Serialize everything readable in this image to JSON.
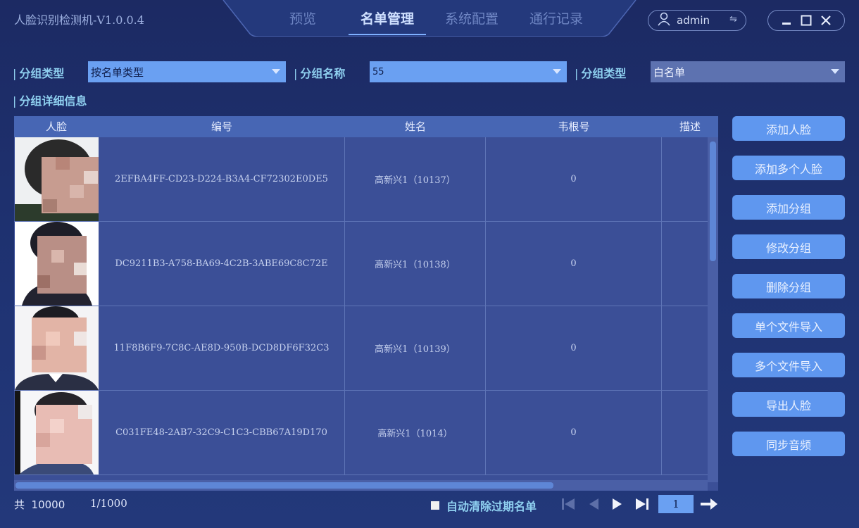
{
  "app": {
    "title": "人脸识别检测机-V1.0.0.4"
  },
  "nav": {
    "tabs": [
      {
        "label": "预览"
      },
      {
        "label": "名单管理"
      },
      {
        "label": "系统配置"
      },
      {
        "label": "通行记录"
      }
    ],
    "active_index": 1
  },
  "user": {
    "name": "admin",
    "switch_icon": "⇋"
  },
  "filters": {
    "group_type_label": "分组类型",
    "group_type_value": "按名单类型",
    "group_name_label": "分组名称",
    "group_name_value": "55",
    "list_type_label": "分组类型",
    "list_type_value": "白名单",
    "detail_label": "分组详细信息"
  },
  "table": {
    "headers": {
      "face": "人脸",
      "id": "编号",
      "name": "姓名",
      "wiegand": "韦根号",
      "desc": "描述"
    },
    "rows": [
      {
        "id": "2EFBA4FF-CD23-D224-B3A4-CF72302E0DE5",
        "name": "高新兴1（10137）",
        "wiegand": "0",
        "desc": ""
      },
      {
        "id": "DC9211B3-A758-BA69-4C2B-3ABE69C8C72E",
        "name": "高新兴1（10138）",
        "wiegand": "0",
        "desc": ""
      },
      {
        "id": "11F8B6F9-7C8C-AE8D-950B-DCD8DF6F32C3",
        "name": "高新兴1（10139）",
        "wiegand": "0",
        "desc": ""
      },
      {
        "id": "C031FE48-2AB7-32C9-C1C3-CBB67A19D170",
        "name": "高新兴1（1014）",
        "wiegand": "0",
        "desc": ""
      }
    ]
  },
  "actions": [
    {
      "label": "添加人脸"
    },
    {
      "label": "添加多个人脸"
    },
    {
      "label": "添加分组"
    },
    {
      "label": "修改分组"
    },
    {
      "label": "删除分组"
    },
    {
      "label": "单个文件导入"
    },
    {
      "label": "多个文件导入"
    },
    {
      "label": "导出人脸"
    },
    {
      "label": "同步音频"
    }
  ],
  "footer": {
    "total": "共  10000",
    "page_info": "1/1000",
    "auto_clear_label": "自动清除过期名单",
    "auto_clear_checked": false,
    "page_input": "1"
  },
  "colors": {
    "accent": "#5f97ef",
    "background": "#1f3373",
    "label": "#8fd0f0"
  }
}
